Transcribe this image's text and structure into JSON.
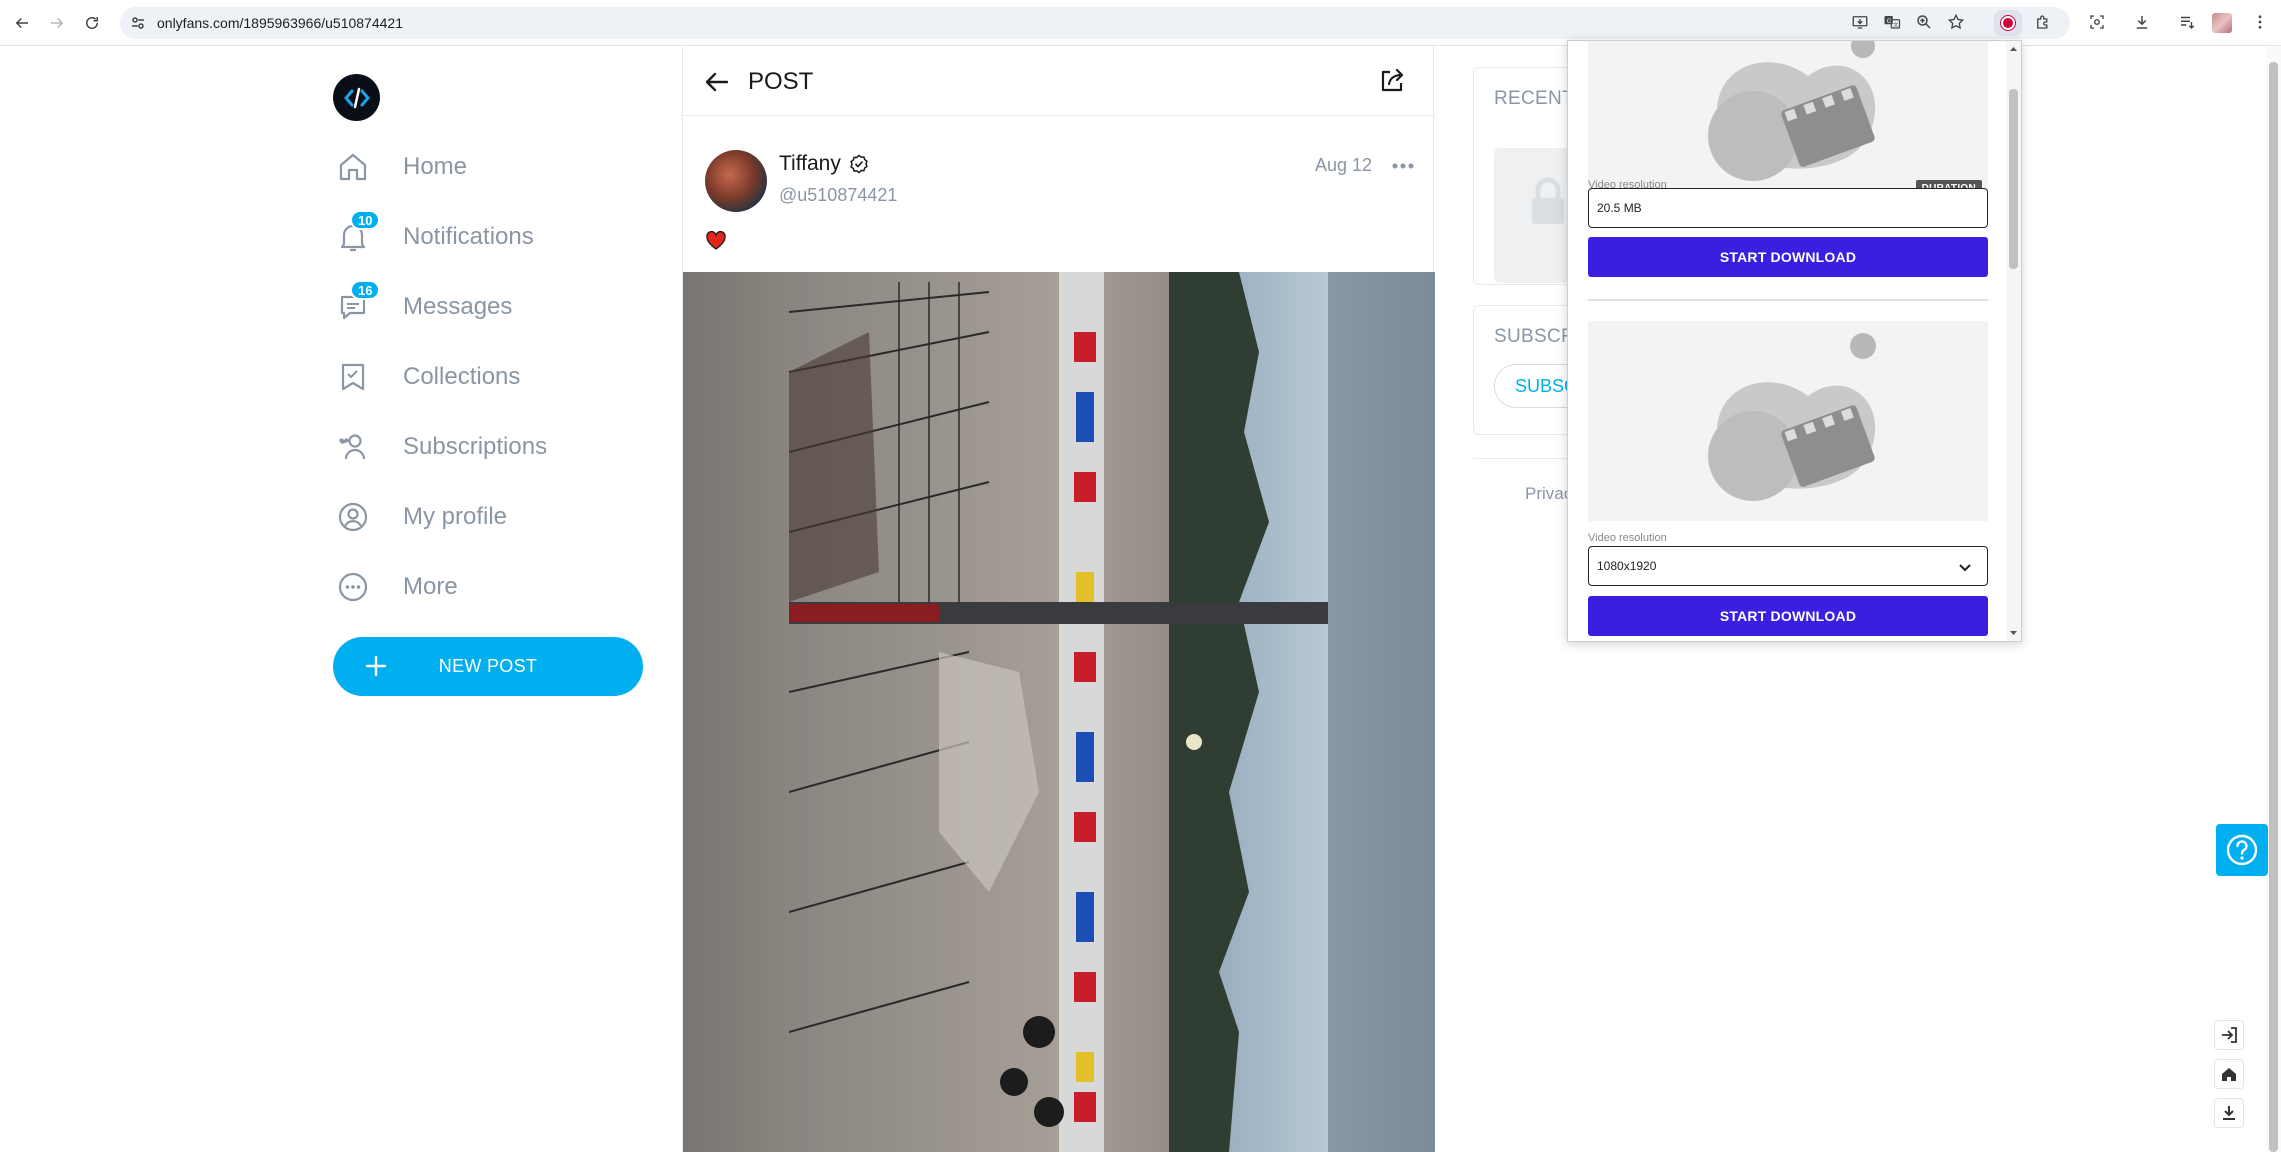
{
  "browser": {
    "url": "onlyfans.com/1895963966/u510874421",
    "icons": [
      "back-icon",
      "forward-icon",
      "reload-icon",
      "site-info-icon",
      "install-app-icon",
      "translate-icon",
      "zoom-icon",
      "bookmark-star-icon",
      "recorder-extension-icon",
      "extensions-puzzle-icon",
      "screenshot-icon",
      "downloads-icon",
      "reading-list-icon",
      "profile-avatar",
      "menu-kebab-icon"
    ]
  },
  "sidebar": {
    "items": [
      {
        "label": "Home",
        "icon": "home-icon"
      },
      {
        "label": "Notifications",
        "icon": "bell-icon",
        "badge": "10"
      },
      {
        "label": "Messages",
        "icon": "chat-icon",
        "badge": "16"
      },
      {
        "label": "Collections",
        "icon": "collections-icon"
      },
      {
        "label": "Subscriptions",
        "icon": "subscriptions-icon"
      },
      {
        "label": "My profile",
        "icon": "profile-icon"
      },
      {
        "label": "More",
        "icon": "more-icon"
      }
    ],
    "new_post_label": "NEW POST"
  },
  "post": {
    "header_title": "POST",
    "author_name": "Tiffany",
    "author_handle": "@u510874421",
    "date": "Aug 12"
  },
  "right": {
    "recent_title": "RECENT",
    "subsc_title": "SUBSCR",
    "subsc_button": "SUBSC",
    "privacy": "Privac"
  },
  "popup": {
    "duration_tag": "DURATION",
    "item1": {
      "res_label": "Video resolution",
      "res_value": "20.5 MB",
      "button": "START DOWNLOAD"
    },
    "item2": {
      "res_label": "Video resolution",
      "res_value": "1080x1920",
      "button": "START DOWNLOAD"
    }
  },
  "colors": {
    "brand": "#00aff0",
    "download_button": "#3a1fe0",
    "muted_text": "#8a96a3",
    "recorder_dot": "#d1003c"
  }
}
